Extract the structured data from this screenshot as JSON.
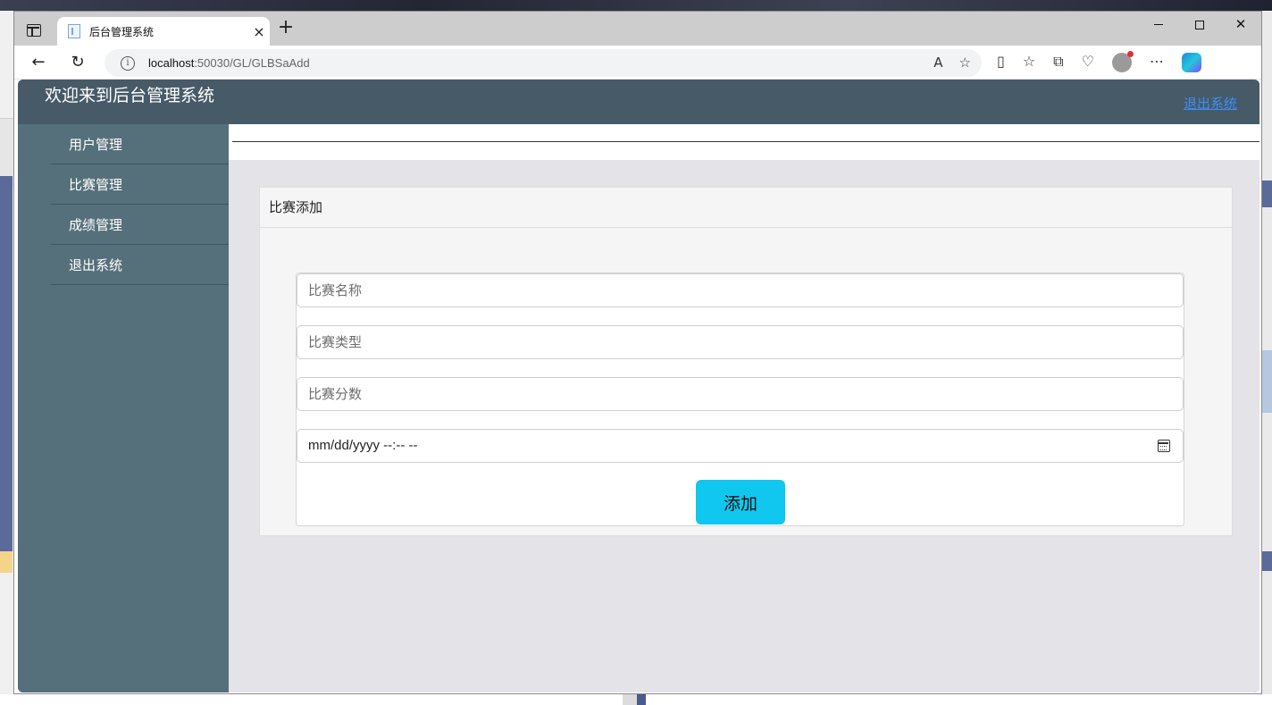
{
  "browser": {
    "tab_title": "后台管理系统",
    "tab_close": "×",
    "new_tab": "+",
    "url_host": "localhost",
    "url_path": ":50030/GL/GLBSaAdd",
    "window_controls": [
      "minimize",
      "maximize",
      "close"
    ],
    "close_glyph": "✕"
  },
  "header": {
    "title": "欢迎来到后台管理系统",
    "logout_link": "退出系统",
    "link_color": "#3b8ff5"
  },
  "sidebar": {
    "items": [
      {
        "label": "用户管理"
      },
      {
        "label": "比赛管理"
      },
      {
        "label": "成绩管理"
      },
      {
        "label": "退出系统"
      }
    ]
  },
  "panel": {
    "heading": "比赛添加"
  },
  "form": {
    "name_placeholder": "比赛名称",
    "type_placeholder": "比赛类型",
    "score_placeholder": "比赛分数",
    "datetime_placeholder": "mm/dd/yyyy --:-- --",
    "submit_label": "添加",
    "submit_color": "#10c8ef"
  },
  "colors": {
    "header_bg": "#475a67",
    "sidebar_bg": "#55707a",
    "main_bg": "#e3e3e8"
  }
}
